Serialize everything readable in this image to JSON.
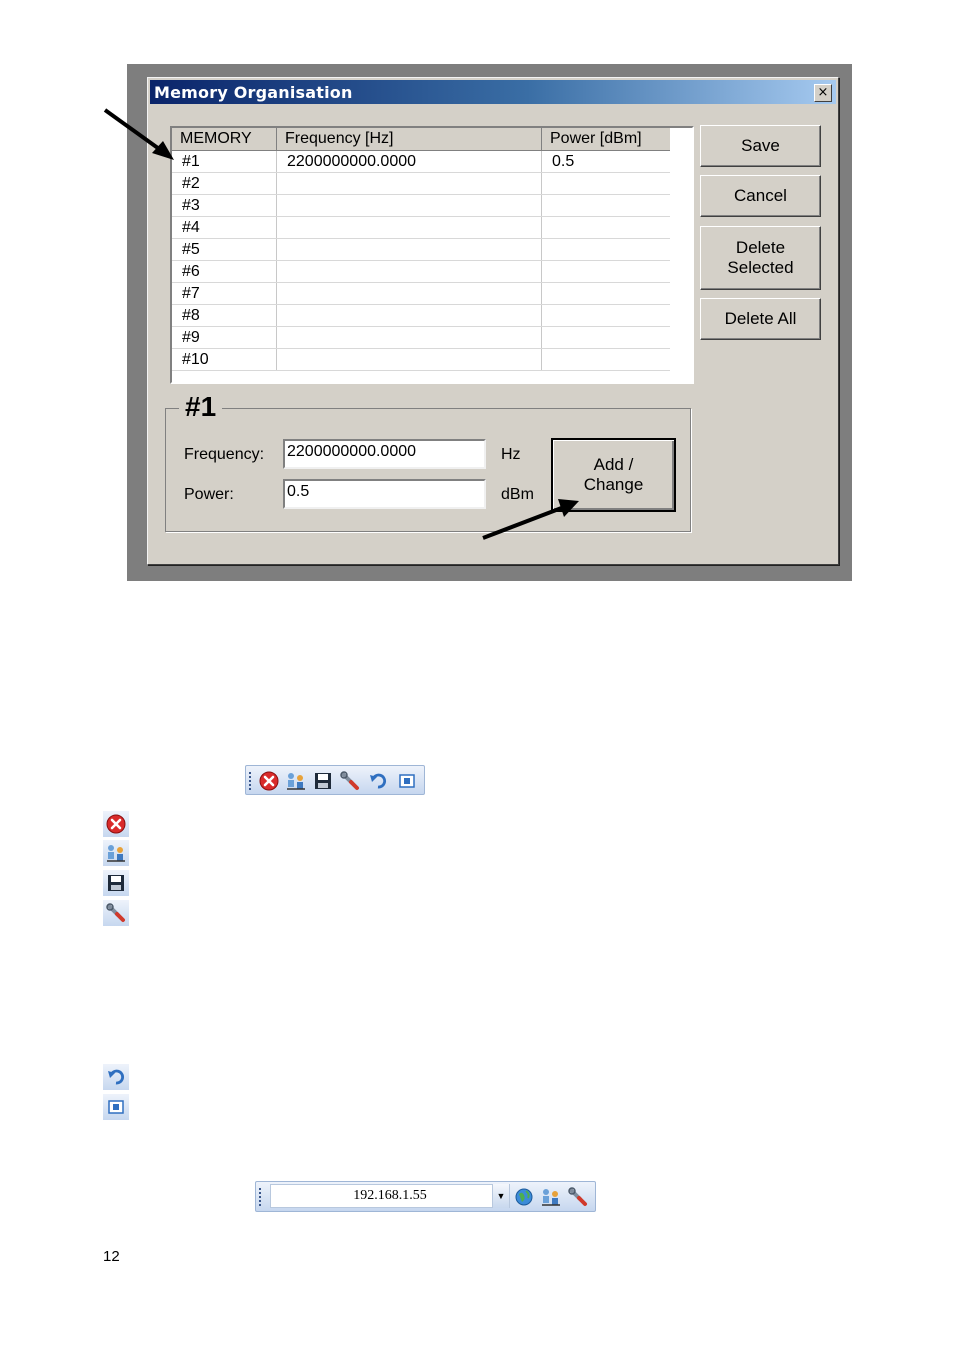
{
  "dialog": {
    "title": "Memory Organisation",
    "close_glyph": "×",
    "table": {
      "headers": [
        "MEMORY",
        "Frequency [Hz]",
        "Power [dBm]"
      ],
      "rows": [
        [
          "#1",
          "2200000000.0000",
          "0.5"
        ],
        [
          "#2",
          "",
          ""
        ],
        [
          "#3",
          "",
          ""
        ],
        [
          "#4",
          "",
          ""
        ],
        [
          "#5",
          "",
          ""
        ],
        [
          "#6",
          "",
          ""
        ],
        [
          "#7",
          "",
          ""
        ],
        [
          "#8",
          "",
          ""
        ],
        [
          "#9",
          "",
          ""
        ],
        [
          "#10",
          "",
          ""
        ]
      ]
    },
    "buttons": {
      "save": "Save",
      "cancel": "Cancel",
      "delete_selected_1": "Delete",
      "delete_selected_2": "Selected",
      "delete_all": "Delete All",
      "add_change_1": "Add /",
      "add_change_2": "Change"
    },
    "group": {
      "title": "#1",
      "frequency_label": "Frequency:",
      "frequency_value": "2200000000.0000",
      "frequency_unit": "Hz",
      "power_label": "Power:",
      "power_value": "0.5",
      "power_unit": "dBm"
    }
  },
  "toolbar1": {
    "icons": [
      "close-icon",
      "connect-icon",
      "save-icon",
      "settings-icon",
      "undo-icon",
      "restore-icon"
    ]
  },
  "legend_icons": [
    "close-icon",
    "connect-icon",
    "save-icon",
    "settings-icon",
    "undo-icon",
    "restore-icon"
  ],
  "toolbar2": {
    "ip_address": "192.168.1.55",
    "icons": [
      "connect-globe-icon",
      "connect-icon",
      "settings-icon"
    ]
  },
  "page_number": "12",
  "colors": {
    "title_bar_start": "#0a246a",
    "dialog_face": "#d4d0c8",
    "toolbar_blue": "#c6d7ef",
    "close_red": "#d92b2b"
  }
}
